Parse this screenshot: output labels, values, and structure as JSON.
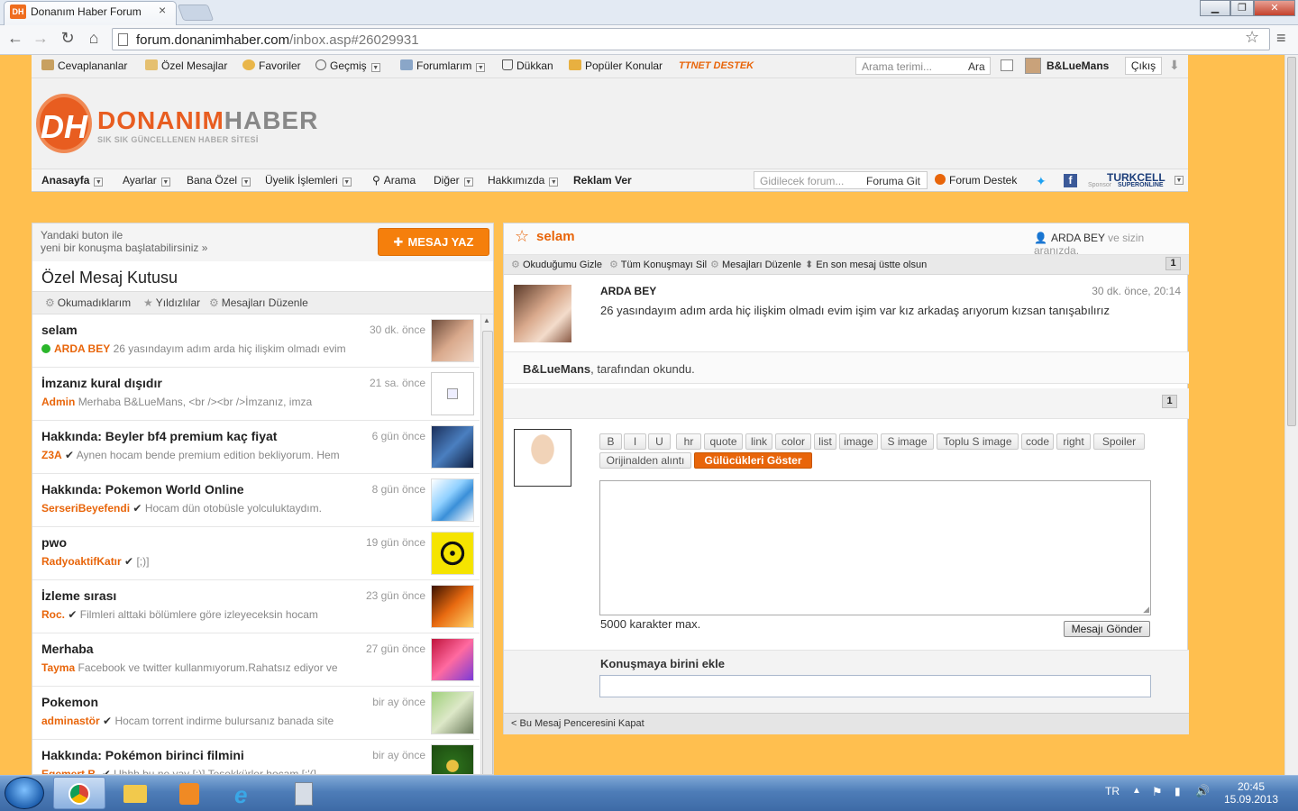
{
  "browser": {
    "tab_title": "Donanım Haber Forum",
    "tab_icon": "DH",
    "url_host": "forum.donanimhaber.com",
    "url_path": "/inbox.asp#26029931"
  },
  "topbar": {
    "items": [
      {
        "label": "Cevaplananlar"
      },
      {
        "label": "Özel Mesajlar"
      },
      {
        "label": "Favoriler"
      },
      {
        "label": "Geçmiş"
      },
      {
        "label": "Forumlarım"
      },
      {
        "label": "Dükkan"
      },
      {
        "label": "Popüler Konular"
      }
    ],
    "ttnet": "TTNET DESTEK",
    "search_placeholder": "Arama terimi...",
    "search_button": "Ara",
    "username": "B&LueMans",
    "logout": "Çıkış"
  },
  "logo": {
    "mark": "DH",
    "name_a": "DONANIM",
    "name_b": "HABER",
    "tagline": "SIK SIK GÜNCELLENEN HABER SİTESİ"
  },
  "mainnav": {
    "items": [
      "Anasayfa",
      "Ayarlar",
      "Bana Özel",
      "Üyelik İşlemleri",
      "Arama",
      "Diğer",
      "Hakkımızda",
      "Reklam Ver"
    ],
    "forum_placeholder": "Gidilecek forum...",
    "forum_go": "Foruma Git",
    "support": "Forum Destek",
    "sponsor_brand": "TURKCELL",
    "sponsor_small": "Sponsor",
    "sponsor_sub": "SUPERONLINE"
  },
  "inbox": {
    "hint_line1": "Yandaki buton ile",
    "hint_line2": "yeni bir konuşma başlatabilirsiniz »",
    "write_button": "MESAJ YAZ",
    "title": "Özel Mesaj Kutusu",
    "sub_unread": "Okumadıklarım",
    "sub_starred": "Yıldızlılar",
    "sub_edit": "Mesajları Düzenle",
    "messages": [
      {
        "title": "selam",
        "time": "30 dk. önce",
        "sender": "ARDA BEY",
        "preview": "26 yasındayım adım arda hiç ilişkim olmadı evim"
      },
      {
        "title": "İmzanız kural dışıdır",
        "time": "21 sa. önce",
        "sender": "Admin",
        "preview": "Merhaba B&LueMans, <br /><br />İmzanız, imza"
      },
      {
        "title": "Hakkında: Beyler bf4 premium kaç fiyat",
        "time": "6 gün önce",
        "sender": "Z3A",
        "preview": "Aynen hocam bende premium edition bekliyorum. Hem"
      },
      {
        "title": "Hakkında: Pokemon World Online",
        "time": "8 gün önce",
        "sender": "SerseriBeyefendi",
        "preview": "Hocam dün otobüsle yolculuktaydım."
      },
      {
        "title": "pwo",
        "time": "19 gün önce",
        "sender": "RadyoaktifKatır",
        "preview": "[;)]"
      },
      {
        "title": "İzleme sırası",
        "time": "23 gün önce",
        "sender": "Roc.",
        "preview": "Filmleri alttaki bölümlere göre izleyeceksin hocam"
      },
      {
        "title": "Merhaba",
        "time": "27 gün önce",
        "sender": "Tayma",
        "preview": "Facebook ve twitter kullanmıyorum.Rahatsız ediyor ve"
      },
      {
        "title": "Pokemon",
        "time": "bir ay önce",
        "sender": "adminastör",
        "preview": "Hocam torrent indirme bulursanız banada site"
      },
      {
        "title": "Hakkında: Pokémon birinci filmini",
        "time": "bir ay önce",
        "sender": "Egemert B.",
        "preview": "Uhhh bu ne yav [:)] Teşekkürler hocam [:'(]"
      }
    ]
  },
  "conversation": {
    "title": "selam",
    "participant": "ARDA BEY",
    "participant_suffix": "ve sizin aranızda.",
    "tools": [
      "Okuduğumu Gizle",
      "Tüm Konuşmayı Sil",
      "Mesajları Düzenle",
      "En son mesaj üstte olsun"
    ],
    "page": "1",
    "message": {
      "user": "ARDA BEY",
      "time": "30 dk. önce, 20:14",
      "text": "26 yasındayım adım arda hiç ilişkim olmadı evim işim var kız arkadaş arıyorum kızsan tanışabılırız"
    },
    "read_by": "B&LueMans",
    "read_suffix": ", tarafından okundu.",
    "editor_buttons": [
      "B",
      "I",
      "U",
      "hr",
      "quote",
      "link",
      "color",
      "list",
      "image",
      "S image",
      "Toplu S image",
      "code",
      "right",
      "Spoiler"
    ],
    "quote_button": "Orijinalden alıntı",
    "smiley_button": "Gülücükleri Göster",
    "max_chars": "5000 karakter max.",
    "send_button": "Mesajı Gönder",
    "add_label": "Konuşmaya birini ekle",
    "close_link": "< Bu Mesaj Penceresini Kapat"
  },
  "taskbar": {
    "lang": "TR",
    "time": "20:45",
    "date": "15.09.2013"
  },
  "colors": {
    "page_bg": "#ffbf4f",
    "accent": "#e8650a",
    "button": "#f57f0c"
  }
}
